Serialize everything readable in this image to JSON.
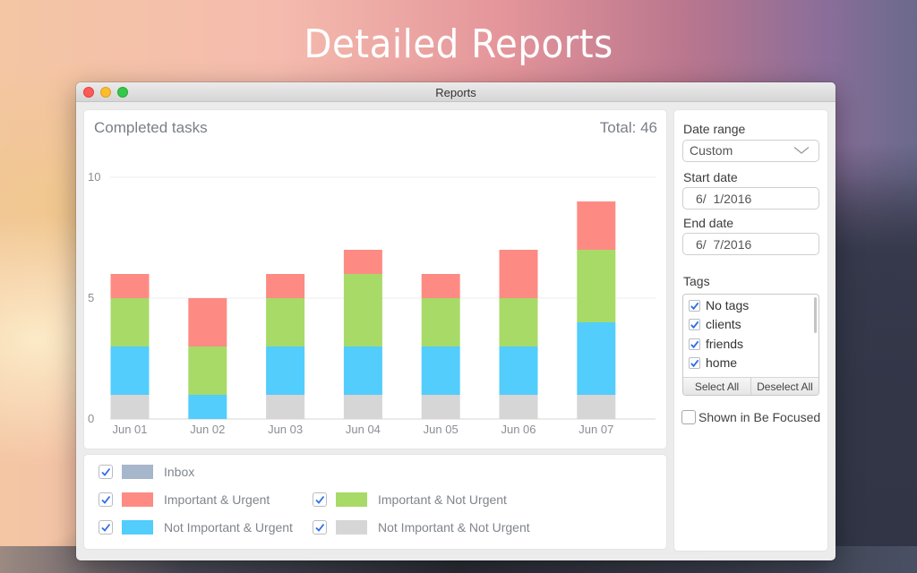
{
  "hero": {
    "title": "Detailed Reports"
  },
  "window": {
    "title": "Reports"
  },
  "chart_panel": {
    "title": "Completed tasks",
    "total_label": "Total: 46"
  },
  "chart_data": {
    "type": "bar",
    "stacked": true,
    "title": "Completed tasks",
    "categories": [
      "Jun 01",
      "Jun 02",
      "Jun 03",
      "Jun 04",
      "Jun 05",
      "Jun 06",
      "Jun 07"
    ],
    "series": [
      {
        "name": "Not Important & Not Urgent",
        "color": "#d6d6d6",
        "values": [
          1,
          0,
          1,
          1,
          1,
          1,
          1
        ]
      },
      {
        "name": "Not Important & Urgent",
        "color": "#52cdfc",
        "values": [
          2,
          1,
          2,
          2,
          2,
          2,
          3
        ]
      },
      {
        "name": "Important & Not Urgent",
        "color": "#a8da68",
        "values": [
          2,
          2,
          2,
          3,
          2,
          2,
          3
        ]
      },
      {
        "name": "Important & Urgent",
        "color": "#fd8b84",
        "values": [
          1,
          2,
          1,
          1,
          1,
          2,
          2
        ]
      },
      {
        "name": "Inbox",
        "color": "#a6b6cb",
        "values": [
          0,
          0,
          0,
          0,
          0,
          0,
          0
        ]
      }
    ],
    "totals": [
      6,
      5,
      6,
      7,
      6,
      7,
      9
    ],
    "total": 46,
    "xlabel": "",
    "ylabel": "",
    "ylim": [
      0,
      10
    ],
    "yticks": [
      0,
      5,
      10
    ],
    "grid": true,
    "legend_position": "bottom"
  },
  "legend": {
    "items": [
      {
        "label": "Inbox",
        "color": "#a6b6cb",
        "checked": true
      },
      {
        "label": "Important & Urgent",
        "color": "#fd8b84",
        "checked": true
      },
      {
        "label": "Important & Not Urgent",
        "color": "#a8da68",
        "checked": true
      },
      {
        "label": "Not Important & Urgent",
        "color": "#52cdfc",
        "checked": true
      },
      {
        "label": "Not Important & Not Urgent",
        "color": "#d6d6d6",
        "checked": true
      }
    ]
  },
  "sidebar": {
    "date_range_label": "Date range",
    "date_range_value": "Custom",
    "start_date_label": "Start date",
    "start_date_value": "6/  1/2016",
    "end_date_label": "End date",
    "end_date_value": "6/  7/2016",
    "tags_label": "Tags",
    "tags": [
      {
        "label": "No tags",
        "checked": true
      },
      {
        "label": "clients",
        "checked": true
      },
      {
        "label": "friends",
        "checked": true
      },
      {
        "label": "home",
        "checked": true
      }
    ],
    "select_all_label": "Select All",
    "deselect_all_label": "Deselect All",
    "shown_in_be_focused_label": "Shown in Be Focused",
    "shown_in_be_focused_checked": false
  },
  "colors": {
    "check": "#2f6ee8"
  }
}
